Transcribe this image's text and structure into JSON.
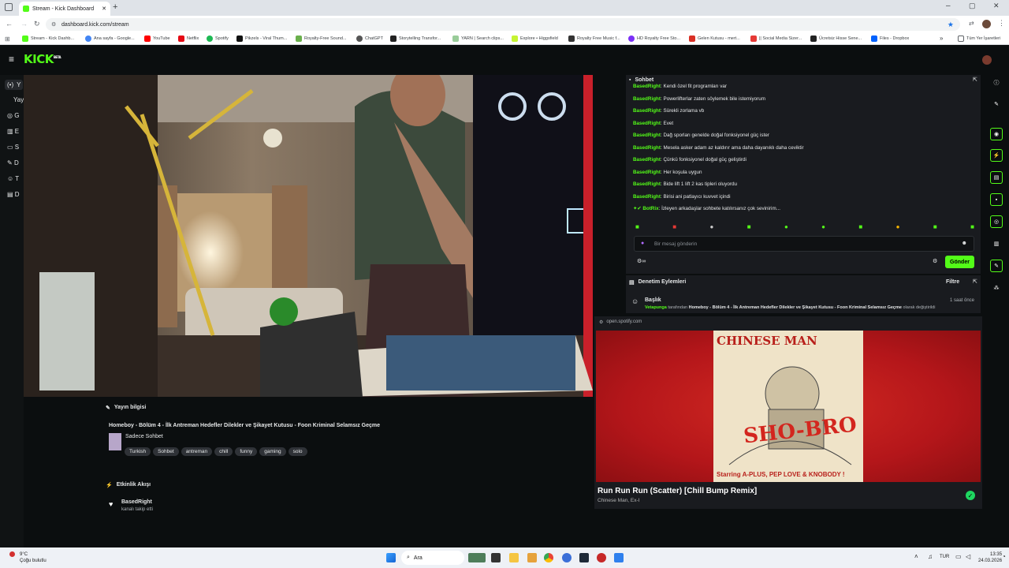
{
  "browser": {
    "tab_title": "Stream - Kick Dashboard",
    "new_tab_icon": "plus",
    "url": "dashboard.kick.com/stream",
    "bookmarks": [
      "Stream - Kick Dashb...",
      "Ana sayfa - Google...",
      "YouTube",
      "Netflix",
      "Spotify",
      "Pikzels - Viral Thum...",
      "Royalty-Free Sound...",
      "ChatGPT",
      "Storytelling Transfor...",
      "YARN | Search clips...",
      "Explore • Higgsfield",
      "Royalty Free Music f...",
      "HD Royalty Free Sto...",
      "Gelen Kutusu - mert...",
      "|| Social Media Sizer...",
      "Ücretsiz Hisse Sene...",
      "Files - Dropbox"
    ],
    "all_bookmarks": "Tüm Yer İşaretleri"
  },
  "kick": {
    "logo": "KICK",
    "logo_badge": "BETA",
    "nav_letters": [
      "Y",
      "Yay",
      "G",
      "E",
      "S",
      "D",
      "T",
      "D"
    ],
    "chat": {
      "header": "Sohbet",
      "messages": [
        {
          "user": "BasedRight",
          "text": "Kendi özel fit programları var"
        },
        {
          "user": "BasedRight",
          "text": "Powerlifterlar zaten söylemek bile istemiyorum"
        },
        {
          "user": "BasedRight",
          "text": "Sürekli zorlama vb"
        },
        {
          "user": "BasedRight",
          "text": "Evet"
        },
        {
          "user": "BasedRight",
          "text": "Dağ sporları genelde doğal fonksiyonel güç ister"
        },
        {
          "user": "BasedRight",
          "text": "Mesela asker adam az kaldırır ama daha dayanıklı daha ceviktir"
        },
        {
          "user": "BasedRight",
          "text": "Çünkü fonksiyonel doğal güç geliştirdi"
        },
        {
          "user": "BasedRight",
          "text": "Her koşula uygun"
        },
        {
          "user": "BasedRight",
          "text": "Bide lift 1 lift 2 kas tipleri oluyordu"
        },
        {
          "user": "BasedRight",
          "text": "Birisi ani patlayıcı kuvvet içindi"
        },
        {
          "user": "BotRix",
          "text": "İzleyen arkadaşlar sohbete katılırsanız çok sevinirim..."
        }
      ],
      "placeholder": "Bir mesaj gönderin",
      "send": "Gönder"
    },
    "mod": {
      "header": "Denetim Eylemleri",
      "filter": "Filtre",
      "title": "Başlık",
      "time": "1 saat önce",
      "actor": "Vetapunga",
      "by": "tarafından",
      "new_title": "Homeboy - Bölüm 4 - İlk Antreman Hedefler Dilekler ve Şikayet Kutusu - Foon Kriminal Selamsız Geçme",
      "changed": "olarak değiştirildi"
    },
    "stream_info": {
      "header": "Yayın bilgisi",
      "title": "Homeboy - Bölüm 4 - İlk Antreman Hedefler Dilekler ve Şikayet Kutusu - Foon Kriminal Selamsız Geçme",
      "category": "Sadece Sohbet",
      "tags": [
        "Turkish",
        "Sohbet",
        "antreman",
        "chill",
        "funny",
        "gaming",
        "solo"
      ]
    },
    "activity": {
      "header": "Etkinlik Akışı",
      "user": "BasedRight",
      "event": "kanalı takip etti"
    }
  },
  "spotify": {
    "source": "open.spotify.com",
    "album_artist": "CHINESE MAN",
    "album_title": "SHO-BRO",
    "album_starring": "Starring A-PLUS, PEP LOVE & KNOBODY !",
    "track": "Run Run Run (Scatter) [Chill Bump Remix]",
    "artists": "Chinese Man, Ex-I"
  },
  "taskbar": {
    "weather_temp": "9°C",
    "weather_text": "Çoğu bulutlu",
    "search": "Ara",
    "lang": "TUR",
    "time": "13:35",
    "date": "24.03.2026"
  },
  "colors": {
    "accent": "#53fc18",
    "panel": "#191b1f",
    "bg": "#0b0e0f",
    "spotify_red": "#c8201e"
  }
}
